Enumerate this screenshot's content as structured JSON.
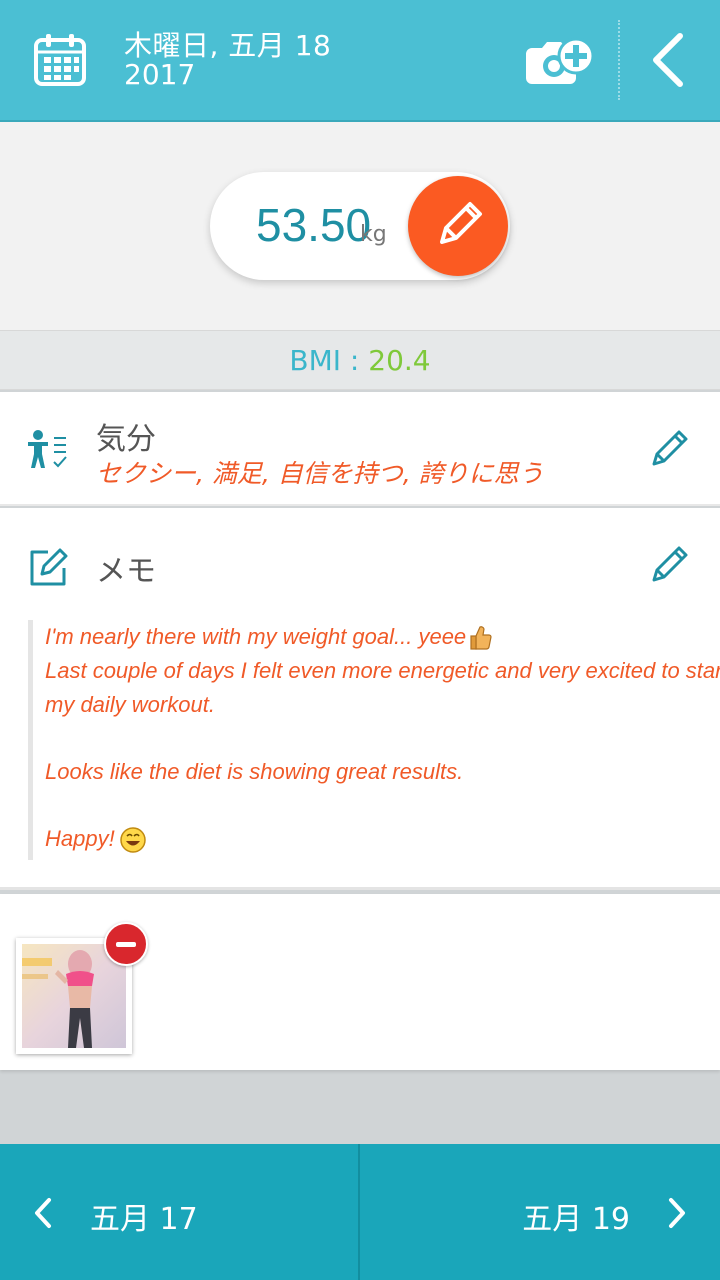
{
  "header": {
    "date_line1": "木曜日, 五月 18",
    "date_line2": "2017"
  },
  "weight": {
    "value": "53.50",
    "unit": "kg"
  },
  "bmi": {
    "label": "BMI",
    "separator": " : ",
    "value": "20.4"
  },
  "mood": {
    "title": "気分",
    "values": "セクシー, 満足, 自信を持つ, 誇りに思う"
  },
  "memo": {
    "title": "メモ",
    "line1": "I'm nearly there with my weight goal... yeee",
    "line2": "Last couple of days I felt even more energetic and very excited to start",
    "line3": "my daily workout.",
    "line4": "Looks like the diet is showing great results.",
    "line5": "Happy!"
  },
  "footer": {
    "prev_label": "五月 17",
    "next_label": "五月 19"
  },
  "colors": {
    "header_bg": "#4bbfd3",
    "footer_bg": "#1aa6ba",
    "accent_orange": "#fb5a22",
    "text_orange": "#f05a28",
    "bmi_green": "#7fc93a",
    "teal": "#1f8fa3"
  },
  "icons": {
    "calendar": "calendar-icon",
    "camera_add": "camera-add-icon",
    "back": "chevron-left-icon",
    "edit": "pencil-icon",
    "mood": "person-checklist-icon",
    "memo": "note-edit-icon",
    "remove": "minus-circle-icon",
    "thumbs_up": "thumbs-up-emoji",
    "happy": "laughing-emoji"
  }
}
